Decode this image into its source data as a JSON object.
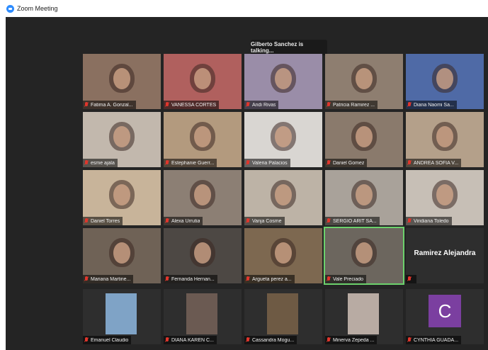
{
  "window": {
    "title": "Zoom Meeting"
  },
  "speaker_banner": "Gilberto Sanchez is talking...",
  "colors": {
    "mic_muted": "#e0362c",
    "active_speaker_border": "#6cd16c",
    "avatar_c": "#7b3fa0",
    "zoom_blue": "#2d8cff"
  },
  "tiles": [
    {
      "name": "Fatima A. Gonzal...",
      "bg": "#8a7060",
      "muted": true
    },
    {
      "name": "VANESSA CORTÉS",
      "bg": "#b0605e",
      "muted": true
    },
    {
      "name": "Andi Rivas",
      "bg": "#9a8da8",
      "muted": true
    },
    {
      "name": "Patricia Ramirez ...",
      "bg": "#8e7e70",
      "muted": true
    },
    {
      "name": "Diana Naomi Sa...",
      "bg": "#4f6aa6",
      "muted": true
    },
    {
      "name": "esme ajala",
      "bg": "#c2b8ad",
      "muted": true
    },
    {
      "name": "Estephanie Guerr...",
      "bg": "#b39a7e",
      "muted": true
    },
    {
      "name": "Valeria Palacios",
      "bg": "#d9d6d2",
      "muted": true
    },
    {
      "name": "Daniel Gomez",
      "bg": "#8a7a6c",
      "muted": true
    },
    {
      "name": "ANDREA SOFIA V...",
      "bg": "#b4a08a",
      "muted": true
    },
    {
      "name": "Daniel Torres",
      "bg": "#c8b49a",
      "muted": true
    },
    {
      "name": "Alexa Urrutia",
      "bg": "#8c7f74",
      "muted": true
    },
    {
      "name": "Vanja Cosme",
      "bg": "#bdb3a6",
      "muted": true
    },
    {
      "name": "SERGIO ARIT SA...",
      "bg": "#a9a29a",
      "muted": true
    },
    {
      "name": "Viridiana Toledo",
      "bg": "#c7bfb6",
      "muted": true
    },
    {
      "name": "Mariana Martine...",
      "bg": "#6f6256",
      "muted": true
    },
    {
      "name": "Fernanda Hernan...",
      "bg": "#4d4844",
      "muted": true
    },
    {
      "name": "Argueta perez a...",
      "bg": "#7d6850",
      "muted": true
    },
    {
      "name": "Vale Preciado",
      "bg": "#6c665e",
      "muted": true,
      "active": true
    },
    {
      "name": "",
      "bg": "#2e2e2e",
      "muted": true,
      "label": "Ramirez Alejandra"
    },
    {
      "name": "Emanuel Claudio",
      "bg": "#2e2e2e",
      "muted": true,
      "cam": "#7fa3c6"
    },
    {
      "name": "DIANA KAREN C...",
      "bg": "#2e2e2e",
      "muted": true,
      "cam": "#6b5a52"
    },
    {
      "name": "Cassandra Mogu...",
      "bg": "#2e2e2e",
      "muted": true,
      "cam": "#6e5a44"
    },
    {
      "name": "Minerva Zepeda ...",
      "bg": "#2e2e2e",
      "muted": true,
      "cam": "#b8aba3"
    },
    {
      "name": "CYNTHIA GUADA...",
      "bg": "#2e2e2e",
      "muted": true,
      "avatar_letter": "C"
    }
  ]
}
